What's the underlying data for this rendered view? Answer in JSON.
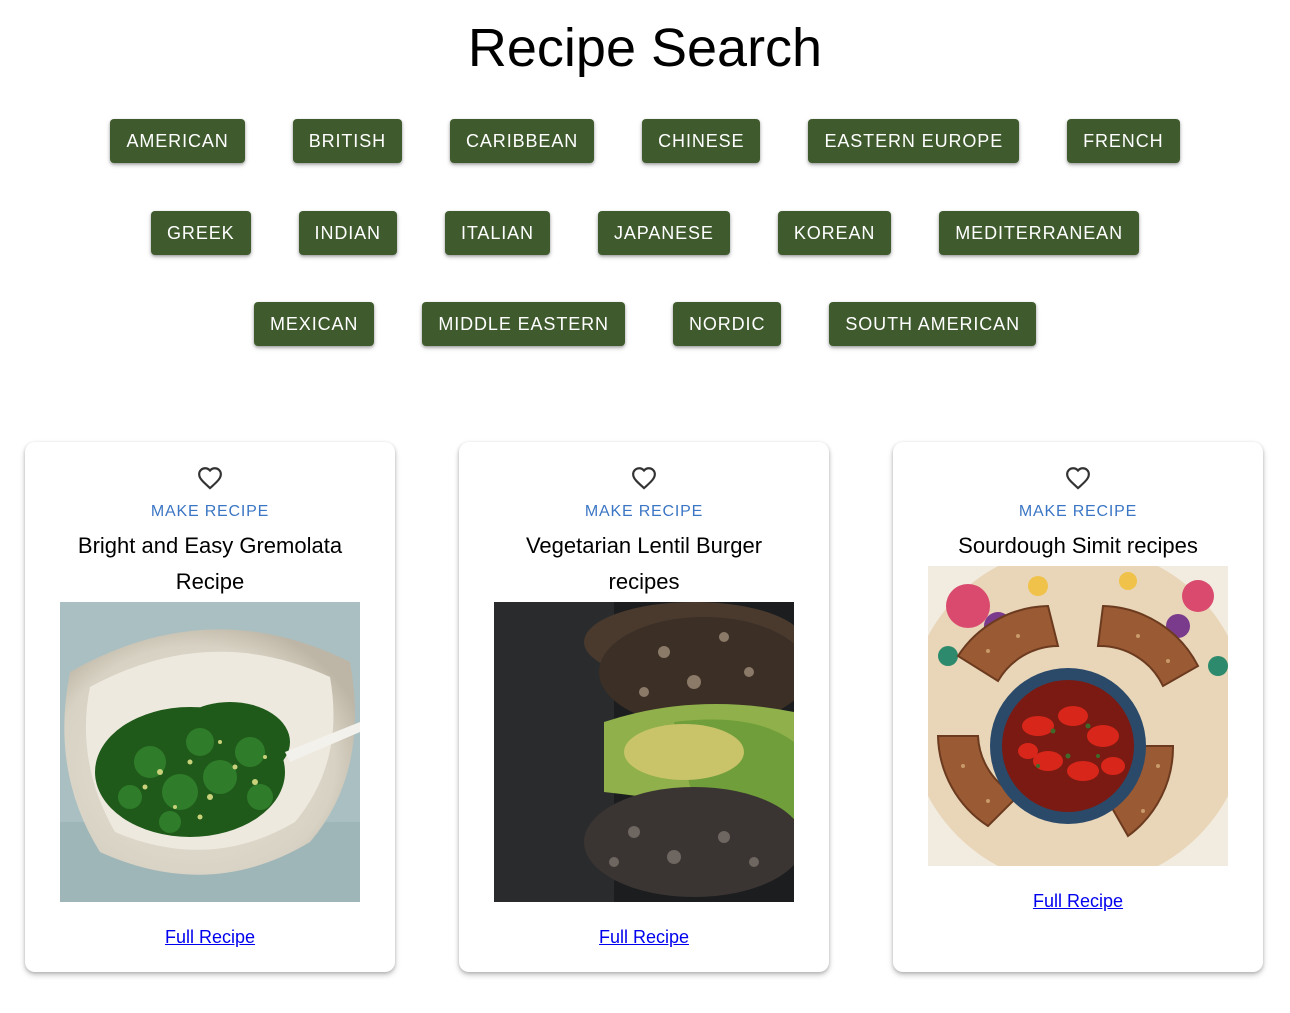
{
  "page": {
    "title": "Recipe Search"
  },
  "cuisines": {
    "row1": [
      "AMERICAN",
      "BRITISH",
      "CARIBBEAN",
      "CHINESE",
      "EASTERN EUROPE",
      "FRENCH"
    ],
    "row2": [
      "GREEK",
      "INDIAN",
      "ITALIAN",
      "JAPANESE",
      "KOREAN",
      "MEDITERRANEAN"
    ],
    "row3": [
      "MEXICAN",
      "MIDDLE EASTERN",
      "NORDIC",
      "SOUTH AMERICAN"
    ]
  },
  "cards": [
    {
      "title": "Bright and Easy Gremolata Recipe",
      "make_label": "MAKE RECIPE",
      "link_label": "Full Recipe",
      "favorite_icon": "heart-outline-icon"
    },
    {
      "title": "Vegetarian Lentil Burger recipes",
      "make_label": "MAKE RECIPE",
      "link_label": "Full Recipe",
      "favorite_icon": "heart-outline-icon"
    },
    {
      "title": "Sourdough Simit recipes",
      "make_label": "MAKE RECIPE",
      "link_label": "Full Recipe",
      "favorite_icon": "heart-outline-icon"
    }
  ],
  "colors": {
    "button_bg": "#3f5b2e",
    "button_text": "#ffffff",
    "make_recipe_link": "#3b76c4",
    "full_recipe_link": "#0000ee"
  }
}
